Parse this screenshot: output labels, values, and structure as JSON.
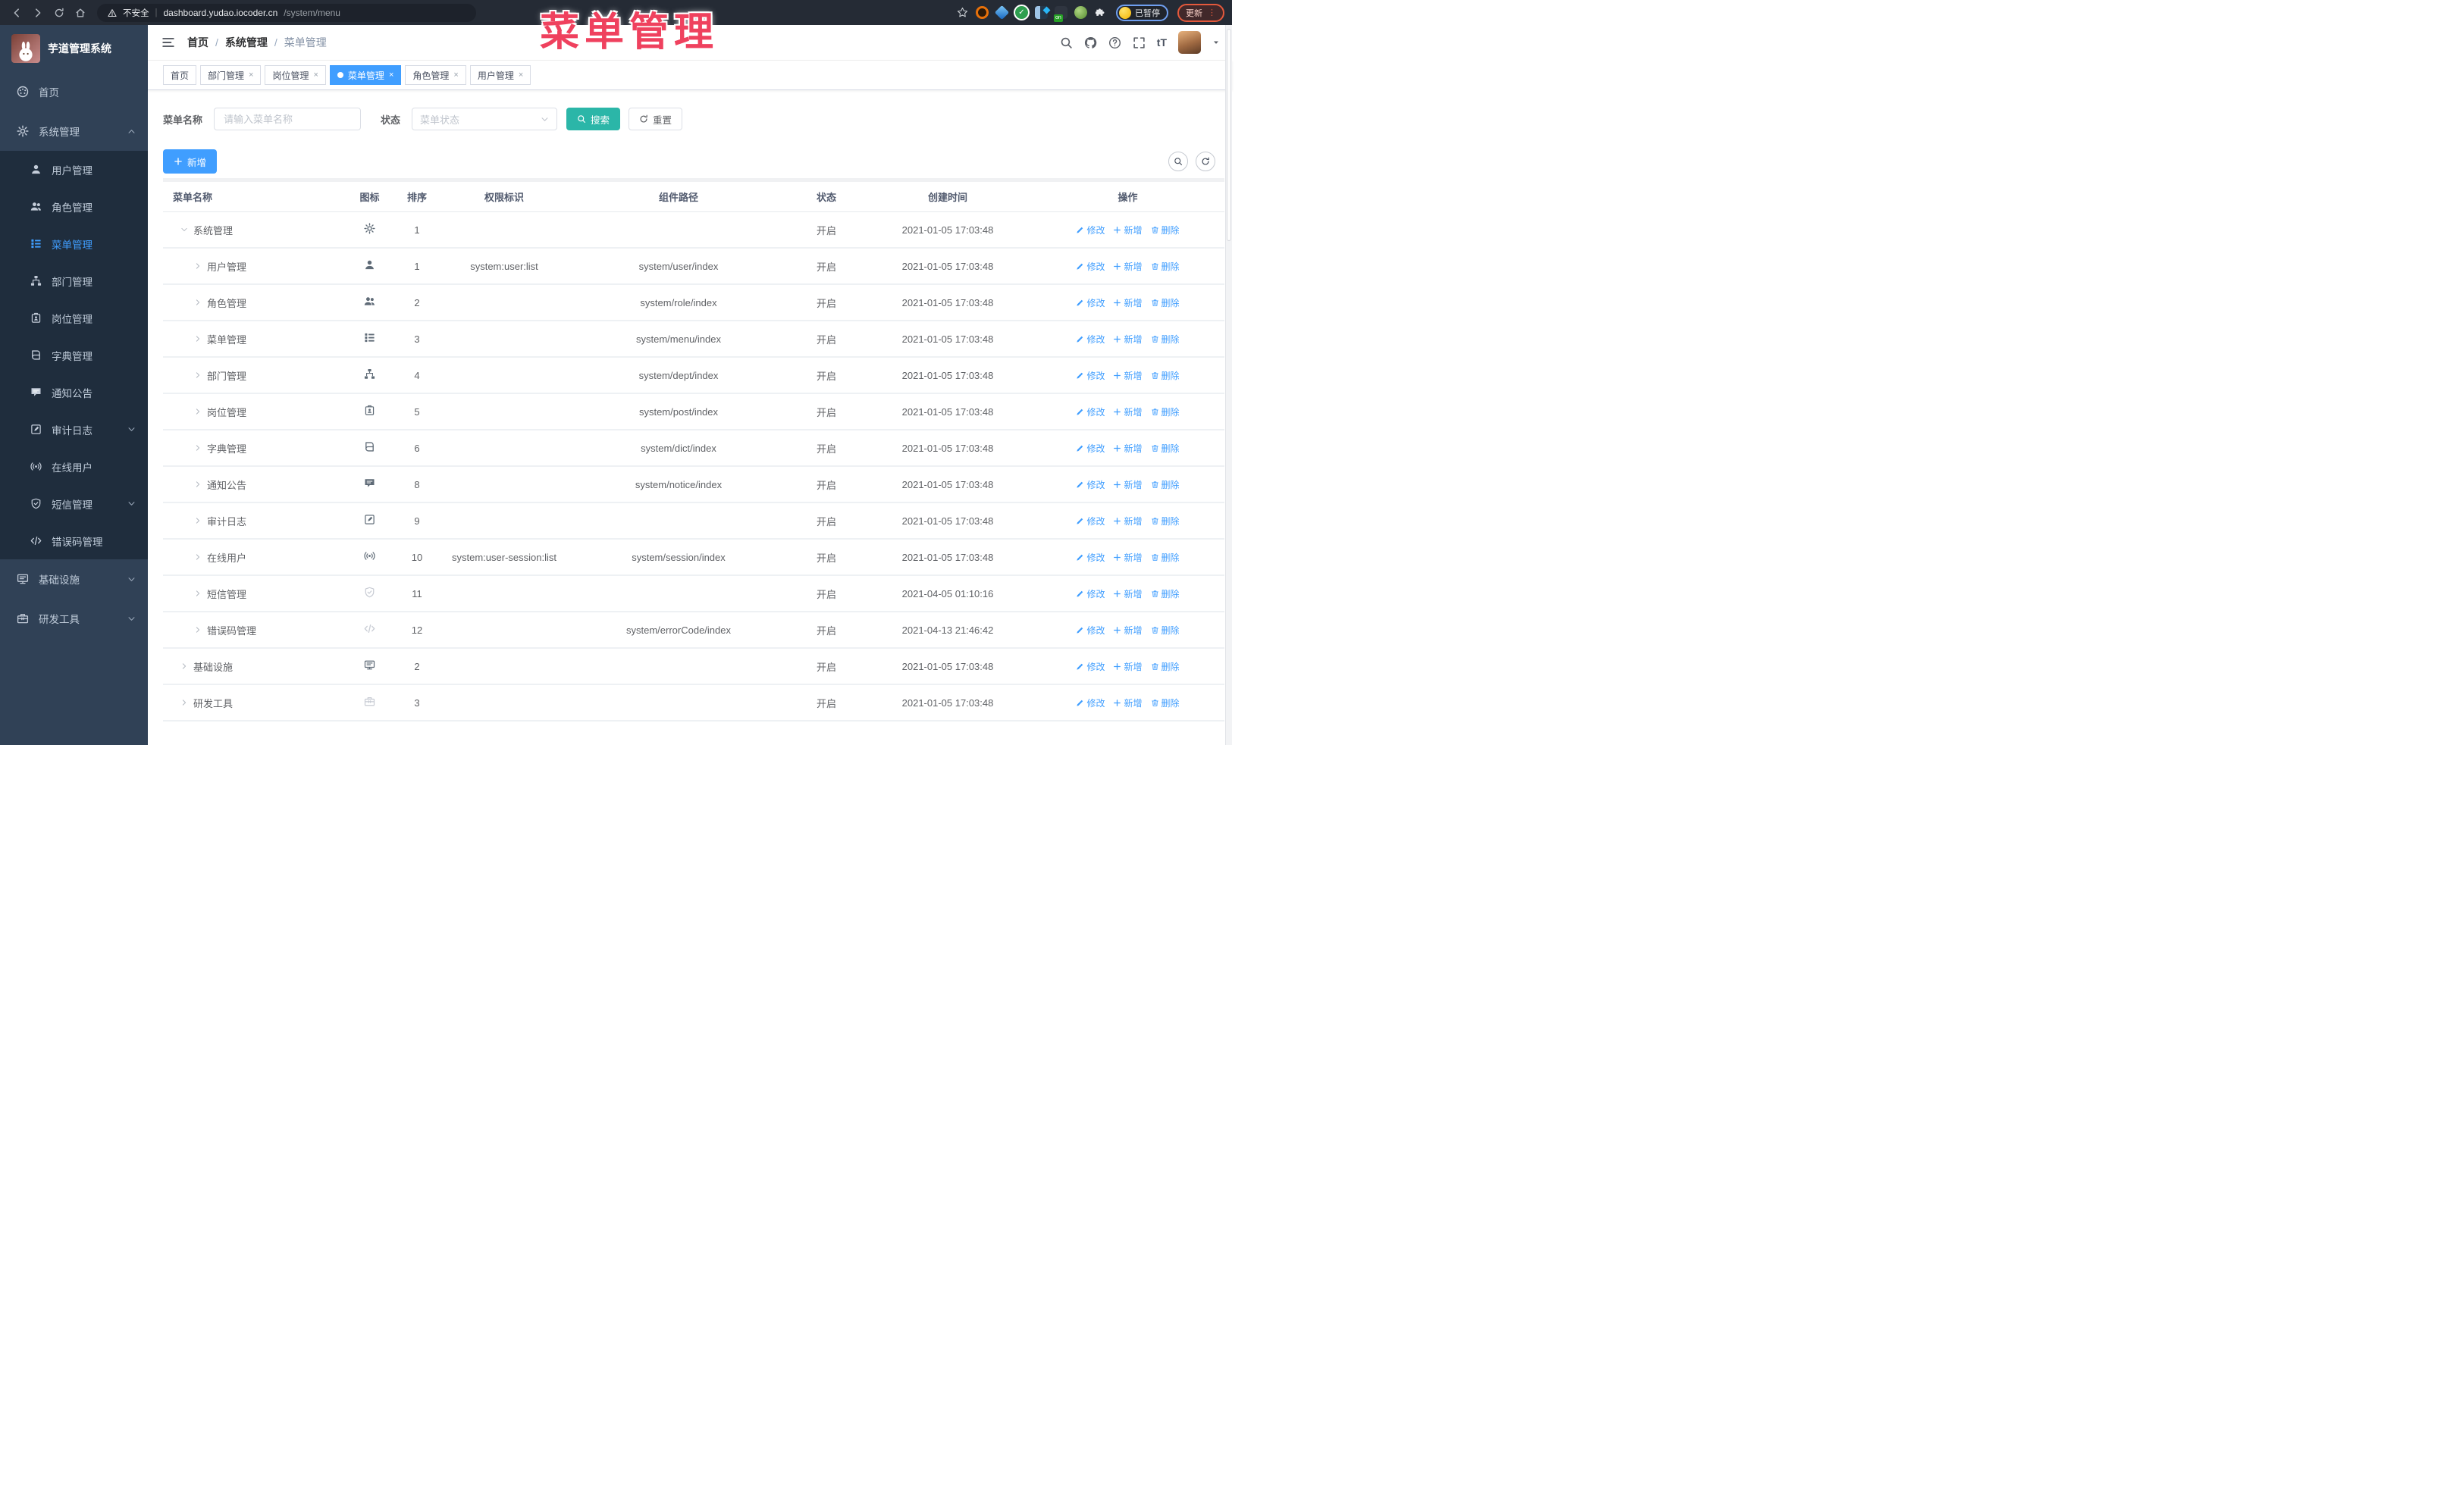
{
  "browser": {
    "security_label": "不安全",
    "url_host": "dashboard.yudao.iocoder.cn",
    "url_path": "/system/menu",
    "paused_badge": "已暂停",
    "update_button": "更新"
  },
  "overlay_title": "菜单管理",
  "sidebar": {
    "logo_title": "芋道管理系统",
    "menu": [
      {
        "label": "首页",
        "icon": "dashboard-icon",
        "level": "top",
        "chevron": "",
        "active": false
      },
      {
        "label": "系统管理",
        "icon": "gear-icon",
        "level": "top",
        "chevron": "up",
        "active": false
      },
      {
        "label": "用户管理",
        "icon": "user-icon",
        "level": "sub",
        "chevron": "",
        "active": false
      },
      {
        "label": "角色管理",
        "icon": "users-icon",
        "level": "sub",
        "chevron": "",
        "active": false
      },
      {
        "label": "菜单管理",
        "icon": "list-icon",
        "level": "sub",
        "chevron": "",
        "active": true
      },
      {
        "label": "部门管理",
        "icon": "tree-icon",
        "level": "sub",
        "chevron": "",
        "active": false
      },
      {
        "label": "岗位管理",
        "icon": "badge-icon",
        "level": "sub",
        "chevron": "",
        "active": false
      },
      {
        "label": "字典管理",
        "icon": "book-icon",
        "level": "sub",
        "chevron": "",
        "active": false
      },
      {
        "label": "通知公告",
        "icon": "message-icon",
        "level": "sub",
        "chevron": "",
        "active": false
      },
      {
        "label": "审计日志",
        "icon": "edit-icon",
        "level": "sub",
        "chevron": "down",
        "active": false
      },
      {
        "label": "在线用户",
        "icon": "online-icon",
        "level": "sub",
        "chevron": "",
        "active": false
      },
      {
        "label": "短信管理",
        "icon": "shield-icon",
        "level": "sub",
        "chevron": "down",
        "active": false
      },
      {
        "label": "错误码管理",
        "icon": "code-icon",
        "level": "sub",
        "chevron": "",
        "active": false
      },
      {
        "label": "基础设施",
        "icon": "monitor-icon",
        "level": "top",
        "chevron": "down",
        "active": false
      },
      {
        "label": "研发工具",
        "icon": "toolbox-icon",
        "level": "top",
        "chevron": "down",
        "active": false
      }
    ]
  },
  "header": {
    "breadcrumb": [
      "首页",
      "系统管理",
      "菜单管理"
    ]
  },
  "tabs": [
    {
      "label": "首页",
      "closable": false,
      "active": false
    },
    {
      "label": "部门管理",
      "closable": true,
      "active": false
    },
    {
      "label": "岗位管理",
      "closable": true,
      "active": false
    },
    {
      "label": "菜单管理",
      "closable": true,
      "active": true
    },
    {
      "label": "角色管理",
      "closable": true,
      "active": false
    },
    {
      "label": "用户管理",
      "closable": true,
      "active": false
    }
  ],
  "search": {
    "name_label": "菜单名称",
    "name_placeholder": "请输入菜单名称",
    "name_value": "",
    "status_label": "状态",
    "status_placeholder": "菜单状态",
    "search_button": "搜索",
    "reset_button": "重置"
  },
  "toolbar": {
    "add_button": "新增"
  },
  "table": {
    "columns": [
      "菜单名称",
      "图标",
      "排序",
      "权限标识",
      "组件路径",
      "状态",
      "创建时间",
      "操作"
    ],
    "actions": {
      "edit": "修改",
      "add": "新增",
      "delete": "删除"
    },
    "rows": [
      {
        "name": "系统管理",
        "icon": "gear-icon",
        "muted": false,
        "level": 0,
        "expanded": true,
        "sort": "1",
        "permission": "",
        "path": "",
        "status": "开启",
        "created": "2021-01-05 17:03:48"
      },
      {
        "name": "用户管理",
        "icon": "user-icon",
        "muted": false,
        "level": 1,
        "expanded": false,
        "sort": "1",
        "permission": "system:user:list",
        "path": "system/user/index",
        "status": "开启",
        "created": "2021-01-05 17:03:48"
      },
      {
        "name": "角色管理",
        "icon": "users-icon",
        "muted": false,
        "level": 1,
        "expanded": false,
        "sort": "2",
        "permission": "",
        "path": "system/role/index",
        "status": "开启",
        "created": "2021-01-05 17:03:48"
      },
      {
        "name": "菜单管理",
        "icon": "list-icon",
        "muted": false,
        "level": 1,
        "expanded": false,
        "sort": "3",
        "permission": "",
        "path": "system/menu/index",
        "status": "开启",
        "created": "2021-01-05 17:03:48"
      },
      {
        "name": "部门管理",
        "icon": "tree-icon",
        "muted": false,
        "level": 1,
        "expanded": false,
        "sort": "4",
        "permission": "",
        "path": "system/dept/index",
        "status": "开启",
        "created": "2021-01-05 17:03:48"
      },
      {
        "name": "岗位管理",
        "icon": "badge-icon",
        "muted": false,
        "level": 1,
        "expanded": false,
        "sort": "5",
        "permission": "",
        "path": "system/post/index",
        "status": "开启",
        "created": "2021-01-05 17:03:48"
      },
      {
        "name": "字典管理",
        "icon": "book-icon",
        "muted": false,
        "level": 1,
        "expanded": false,
        "sort": "6",
        "permission": "",
        "path": "system/dict/index",
        "status": "开启",
        "created": "2021-01-05 17:03:48"
      },
      {
        "name": "通知公告",
        "icon": "message-icon",
        "muted": false,
        "level": 1,
        "expanded": false,
        "sort": "8",
        "permission": "",
        "path": "system/notice/index",
        "status": "开启",
        "created": "2021-01-05 17:03:48"
      },
      {
        "name": "审计日志",
        "icon": "edit-icon",
        "muted": false,
        "level": 1,
        "expanded": false,
        "sort": "9",
        "permission": "",
        "path": "",
        "status": "开启",
        "created": "2021-01-05 17:03:48"
      },
      {
        "name": "在线用户",
        "icon": "online-icon",
        "muted": false,
        "level": 1,
        "expanded": false,
        "sort": "10",
        "permission": "system:user-session:list",
        "path": "system/session/index",
        "status": "开启",
        "created": "2021-01-05 17:03:48"
      },
      {
        "name": "短信管理",
        "icon": "shield-icon",
        "muted": true,
        "level": 1,
        "expanded": false,
        "sort": "11",
        "permission": "",
        "path": "",
        "status": "开启",
        "created": "2021-04-05 01:10:16"
      },
      {
        "name": "错误码管理",
        "icon": "code-icon",
        "muted": true,
        "level": 1,
        "expanded": false,
        "sort": "12",
        "permission": "",
        "path": "system/errorCode/index",
        "status": "开启",
        "created": "2021-04-13 21:46:42"
      },
      {
        "name": "基础设施",
        "icon": "monitor-icon",
        "muted": false,
        "level": 0,
        "expanded": false,
        "sort": "2",
        "permission": "",
        "path": "",
        "status": "开启",
        "created": "2021-01-05 17:03:48"
      },
      {
        "name": "研发工具",
        "icon": "toolbox-icon",
        "muted": true,
        "level": 0,
        "expanded": false,
        "sort": "3",
        "permission": "",
        "path": "",
        "status": "开启",
        "created": "2021-01-05 17:03:48"
      }
    ]
  },
  "colors": {
    "accent": "#409eff",
    "search_button": "#2bb6a8",
    "overlay_text": "#ef415e",
    "sidebar_bg": "#304156",
    "submenu_bg": "#1f2d3d"
  }
}
